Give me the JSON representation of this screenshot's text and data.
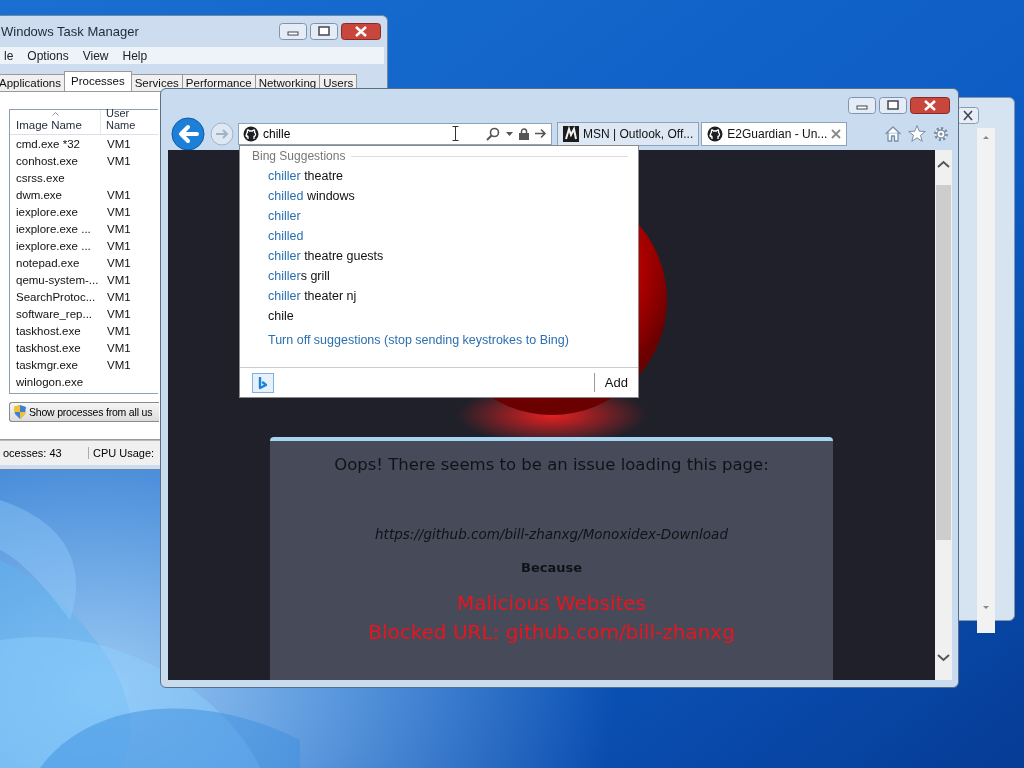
{
  "task_manager": {
    "title": "Windows Task Manager",
    "menu": [
      "le",
      "Options",
      "View",
      "Help"
    ],
    "tabs": [
      {
        "label": "Applications",
        "selected": false
      },
      {
        "label": "Processes",
        "selected": true
      },
      {
        "label": "Services",
        "selected": false
      },
      {
        "label": "Performance",
        "selected": false
      },
      {
        "label": "Networking",
        "selected": false
      },
      {
        "label": "Users",
        "selected": false
      }
    ],
    "columns": [
      "Image Name",
      "User Name"
    ],
    "rows": [
      {
        "image_name": "cmd.exe *32",
        "user_name": "VM1"
      },
      {
        "image_name": "conhost.exe",
        "user_name": "VM1"
      },
      {
        "image_name": "csrss.exe"
      },
      {
        "image_name": "dwm.exe",
        "user_name": "VM1"
      },
      {
        "image_name": "iexplore.exe",
        "user_name": "VM1"
      },
      {
        "image_name": "iexplore.exe ...",
        "user_name": "VM1"
      },
      {
        "image_name": "iexplore.exe ...",
        "user_name": "VM1"
      },
      {
        "image_name": "notepad.exe",
        "user_name": "VM1"
      },
      {
        "image_name": "qemu-system-...",
        "user_name": "VM1"
      },
      {
        "image_name": "SearchProtoc...",
        "user_name": "VM1"
      },
      {
        "image_name": "software_rep...",
        "user_name": "VM1"
      },
      {
        "image_name": "taskhost.exe",
        "user_name": "VM1"
      },
      {
        "image_name": "taskhost.exe",
        "user_name": "VM1"
      },
      {
        "image_name": "taskmgr.exe",
        "user_name": "VM1"
      },
      {
        "image_name": "winlogon.exe"
      }
    ],
    "button": "Show processes from all us",
    "status_bar": [
      "ocesses: 43",
      "CPU Usage:"
    ]
  },
  "browser": {
    "address": "chille",
    "tabs": [
      {
        "label": "MSN | Outlook, Off...",
        "selected": false
      },
      {
        "label": "E2Guardian - Un...",
        "selected": true
      }
    ],
    "suggestions": {
      "header": "Bing Suggestions",
      "items": [
        {
          "match": "chiller",
          "rest": " theatre"
        },
        {
          "match": "chilled",
          "rest": " windows"
        },
        {
          "match": "chiller"
        },
        {
          "match": "chilled"
        },
        {
          "match": "chiller",
          "rest": " theatre guests"
        },
        {
          "match": "chiller",
          "rest": "s grill"
        },
        {
          "match": "chiller",
          "rest": " theater nj"
        },
        {
          "rest": "chile"
        }
      ],
      "turn_off_link": "Turn off suggestions (stop sending keystrokes to Bing)",
      "add_button": "Add"
    },
    "page": {
      "heading": "Oops! There seems to be an issue loading this page:",
      "url": "https://github.com/bill-zhanxg/Monoxidex-Download",
      "because": "Because",
      "reasons": [
        "Malicious Websites",
        "Blocked URL: github.com/bill-zhanxg"
      ]
    }
  }
}
